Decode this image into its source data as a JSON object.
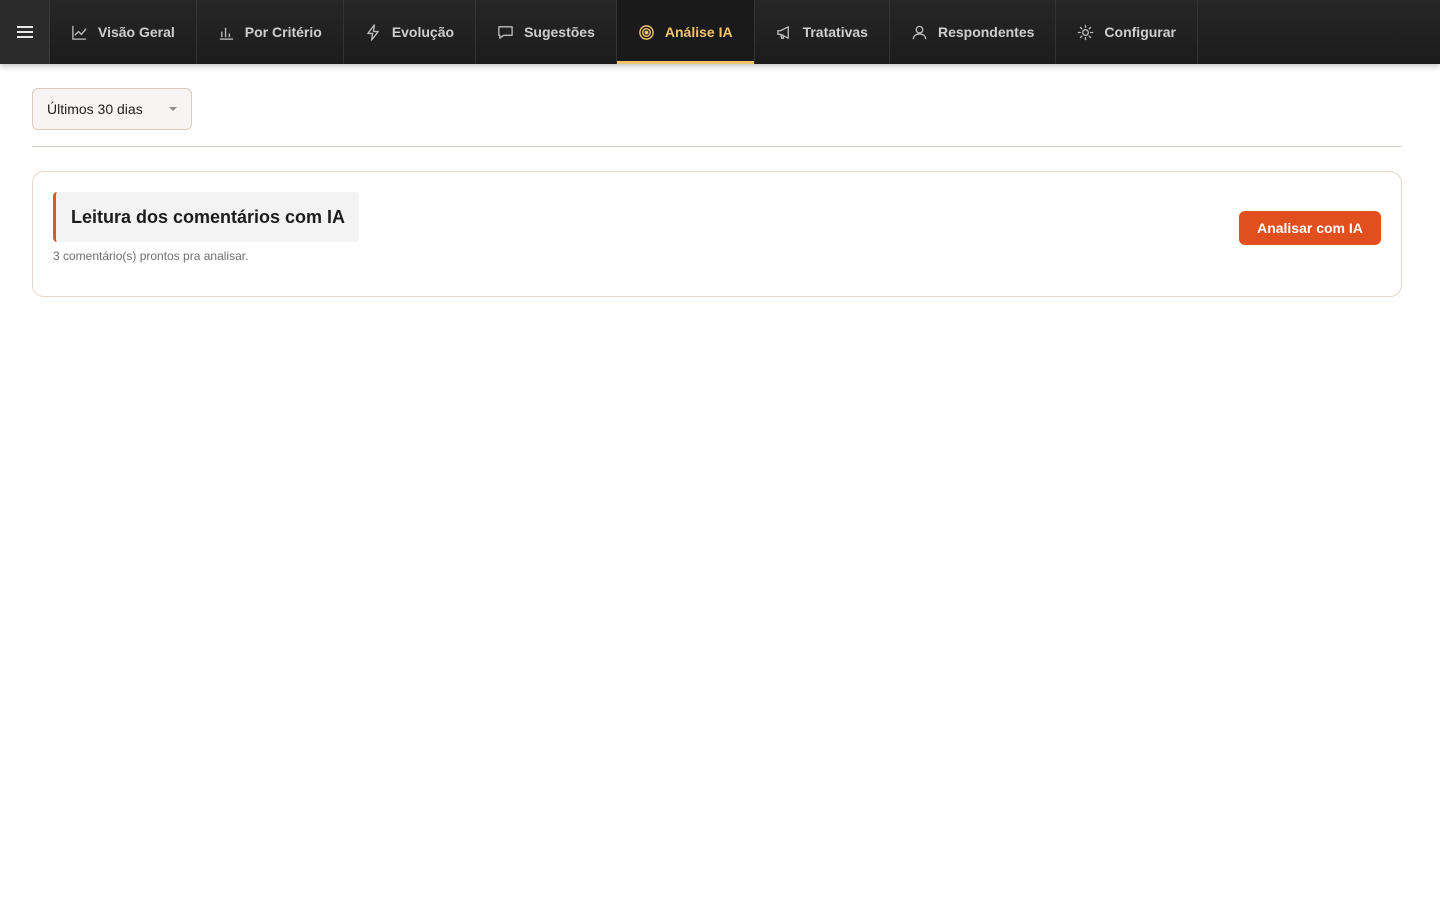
{
  "nav": {
    "menu_icon": "hamburger-menu-icon",
    "tabs": [
      {
        "label": "Visão Geral",
        "icon": "line-chart-icon",
        "active": false
      },
      {
        "label": "Por Critério",
        "icon": "bar-chart-icon",
        "active": false
      },
      {
        "label": "Evolução",
        "icon": "lightning-icon",
        "active": false
      },
      {
        "label": "Sugestões",
        "icon": "chat-bubble-icon",
        "active": false
      },
      {
        "label": "Análise IA",
        "icon": "target-icon",
        "active": true
      },
      {
        "label": "Tratativas",
        "icon": "megaphone-icon",
        "active": false
      },
      {
        "label": "Respondentes",
        "icon": "user-icon",
        "active": false
      },
      {
        "label": "Configurar",
        "icon": "gear-icon",
        "active": false
      }
    ]
  },
  "filter": {
    "period_value": "Últimos 30 dias"
  },
  "card": {
    "title": "Leitura dos comentários com IA",
    "subtitle": "3 comentário(s) prontos pra analisar.",
    "button_label": "Analisar com IA"
  },
  "colors": {
    "accent": "#e24f1e",
    "active_tab": "#f2c46b",
    "topbar": "#1f1f1f"
  }
}
